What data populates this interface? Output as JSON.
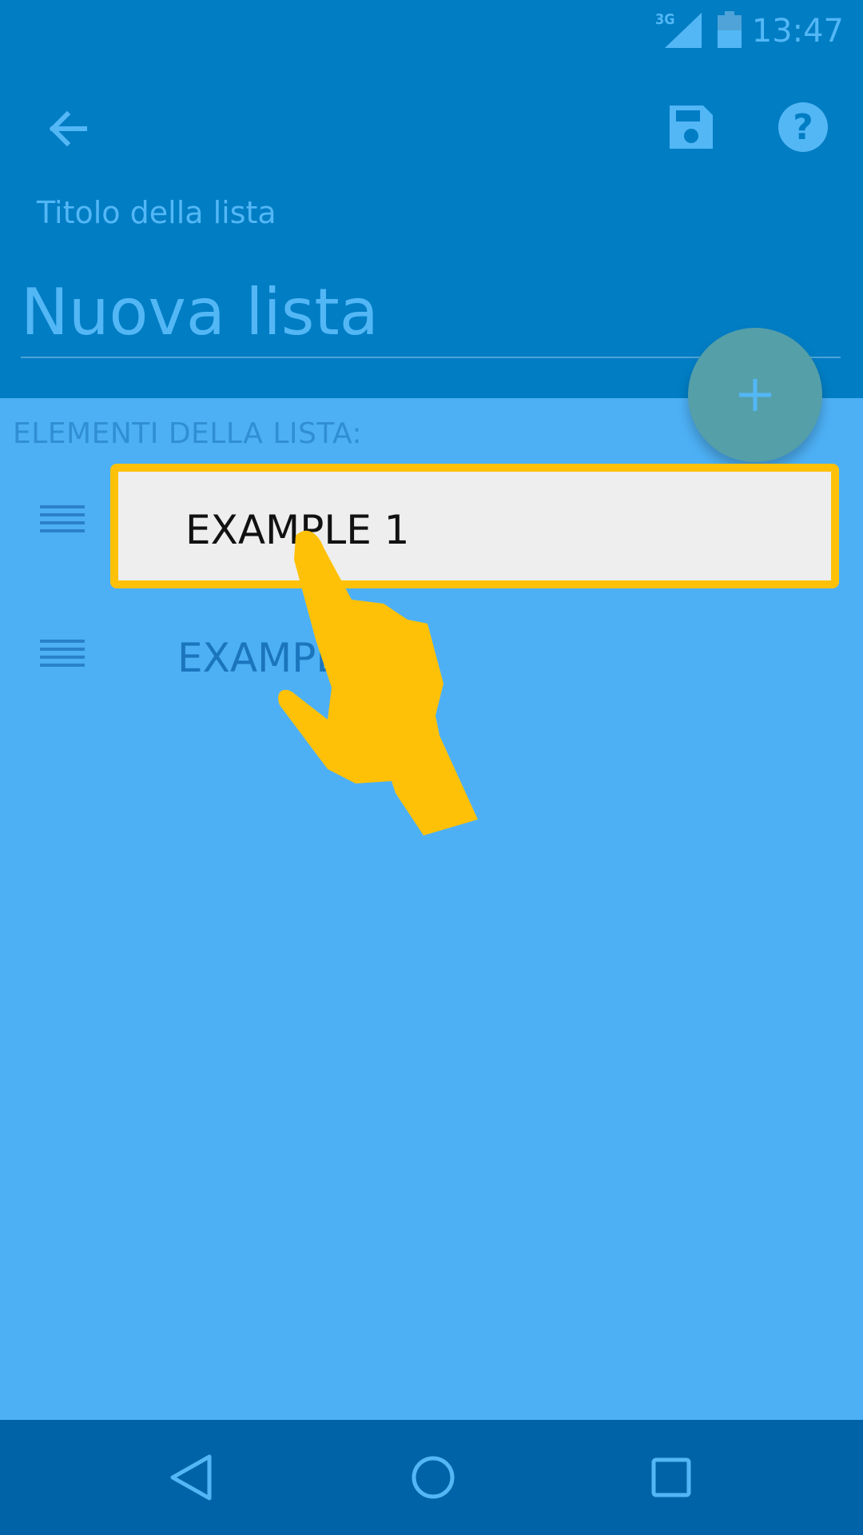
{
  "status_bar": {
    "network": "3G",
    "time": "13:47",
    "icons": [
      "signal-icon",
      "battery-icon"
    ]
  },
  "app_bar": {
    "icons": [
      "arrow-back-icon",
      "save-icon",
      "help-icon"
    ],
    "title_label": "Titolo della lista",
    "title_value": "Nuova lista"
  },
  "fab": {
    "icon": "plus-icon"
  },
  "list": {
    "section_label": "ELEMENTI DELLA LISTA:",
    "items": [
      {
        "label": "EXAMPLE 1",
        "icon": "drag-handle-icon"
      },
      {
        "label": "EXAMPLE 2",
        "icon": "drag-handle-icon"
      }
    ]
  },
  "tutorial": {
    "icon": "hand-pointer-icon"
  },
  "nav_bar": {
    "icons": [
      "nav-back-icon",
      "nav-home-icon",
      "nav-recents-icon"
    ]
  },
  "colors": {
    "primary_dark": "#017DC4",
    "background": "#4DB0F5",
    "accent_text": "#53B7F6",
    "fab": "#559FA9",
    "highlight": "#FFC107",
    "nav_bar": "#0163A7"
  }
}
